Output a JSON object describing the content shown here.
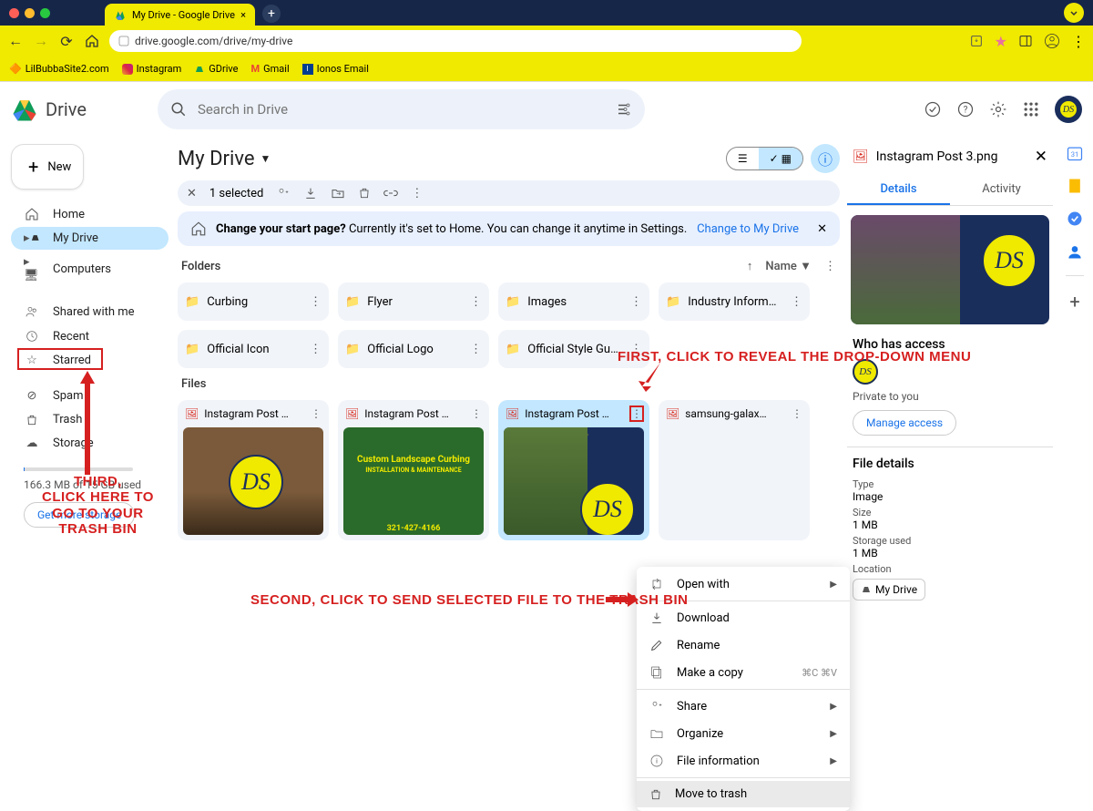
{
  "browser": {
    "tab_title": "My Drive - Google Drive",
    "url": "drive.google.com/drive/my-drive",
    "bookmarks": [
      "LilBubbaSite2.com",
      "Instagram",
      "GDrive",
      "Gmail",
      "Ionos Email"
    ]
  },
  "drive": {
    "app_name": "Drive",
    "search_placeholder": "Search in Drive",
    "new_btn": "New",
    "nav": {
      "home": "Home",
      "my_drive": "My Drive",
      "computers": "Computers",
      "shared": "Shared with me",
      "recent": "Recent",
      "starred": "Starred",
      "spam": "Spam",
      "trash": "Trash",
      "storage": "Storage"
    },
    "storage_used": "166.3 MB of 15 GB used",
    "get_more": "Get more storage",
    "breadcrumb": "My Drive",
    "selected_text": "1 selected",
    "notice": {
      "strong": "Change your start page?",
      "rest": "Currently it's set to Home. You can change it anytime in Settings.",
      "action": "Change to My Drive"
    },
    "sections": {
      "folders": "Folders",
      "files": "Files"
    },
    "sort_label": "Name",
    "folders": [
      "Curbing",
      "Flyer",
      "Images",
      "Industry Inform…",
      "Official Icon",
      "Official Logo",
      "Official Style Gu…"
    ],
    "files": [
      "Instagram Post …",
      "Instagram Post …",
      "Instagram Post …",
      "samsung-galax…"
    ]
  },
  "context_menu": {
    "open_with": "Open with",
    "download": "Download",
    "rename": "Rename",
    "make_copy": "Make a copy",
    "copy_kbd": "⌘C ⌘V",
    "share": "Share",
    "organize": "Organize",
    "file_info": "File information",
    "move_trash": "Move to trash"
  },
  "details": {
    "filename": "Instagram Post 3.png",
    "tab_details": "Details",
    "tab_activity": "Activity",
    "who_access": "Who has access",
    "private": "Private to you",
    "manage": "Manage access",
    "file_details": "File details",
    "type_l": "Type",
    "type_v": "Image",
    "size_l": "Size",
    "size_v": "1 MB",
    "storage_l": "Storage used",
    "storage_v": "1 MB",
    "location_l": "Location",
    "location_chip": "My Drive"
  },
  "annotations": {
    "first": "FIRST, CLICK TO REVEAL THE DROP-DOWN MENU",
    "second": "SECOND, CLICK TO SEND SELECTED FILE TO THE TRASH BIN",
    "third": "THIRD,\nCLICK HERE TO\nGO TO YOUR\nTRASH BIN"
  }
}
